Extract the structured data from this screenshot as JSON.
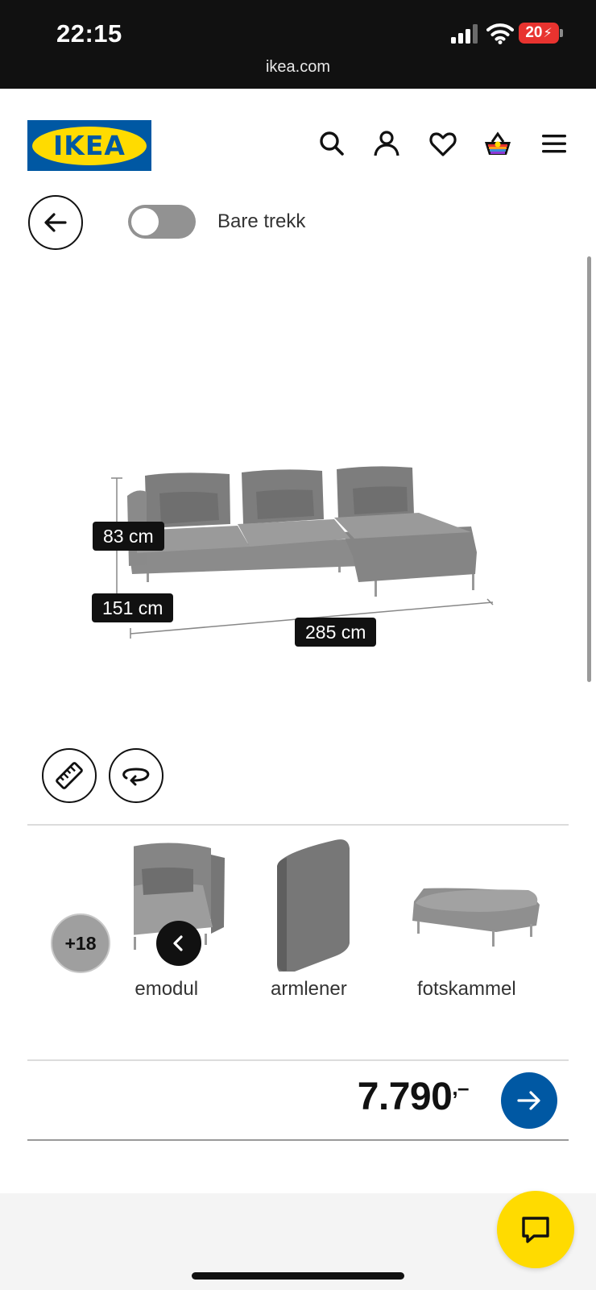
{
  "status_bar": {
    "time": "22:15",
    "battery": "20",
    "url": "ikea.com"
  },
  "header": {
    "logo_text": "IKEA",
    "icons": [
      "search-icon",
      "account-icon",
      "favourites-icon",
      "basket-icon",
      "menu-icon"
    ]
  },
  "controls": {
    "toggle_label": "Bare trekk",
    "toggle_on": false
  },
  "product": {
    "dimensions": {
      "height": "83 cm",
      "depth": "151 cm",
      "width": "285 cm"
    }
  },
  "carousel": {
    "more_count": "+18",
    "modules": [
      {
        "label": "nemodul"
      },
      {
        "label": "armlener"
      },
      {
        "label": "fotskammel"
      }
    ]
  },
  "summary": {
    "price": "7.790",
    "price_suffix": ",–"
  },
  "colors": {
    "ikea_blue": "#0058a3",
    "ikea_yellow": "#ffdb00",
    "status_bg": "#111111"
  }
}
